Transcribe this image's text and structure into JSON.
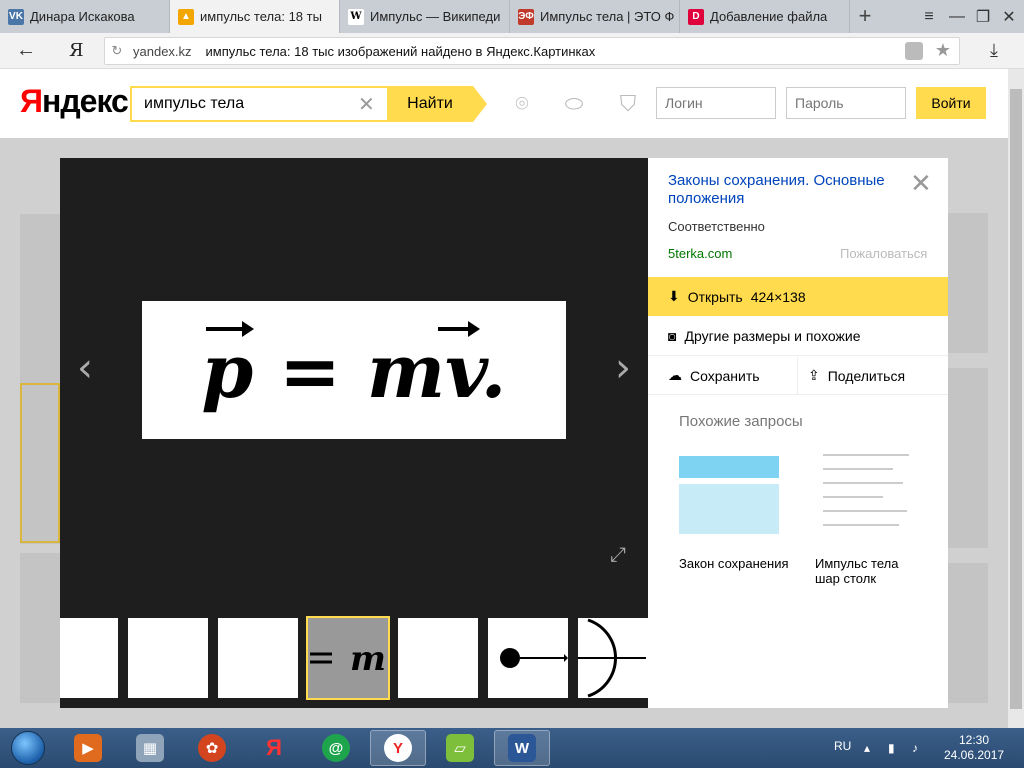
{
  "browser": {
    "tabs": [
      {
        "label": "Динара Искакова",
        "favicon": "vk-icon",
        "color": "#4a76a8",
        "active": false
      },
      {
        "label": "импульс тела: 18 ты",
        "favicon": "yandex-images-icon",
        "color": "#f3a600",
        "active": true
      },
      {
        "label": "Импульс — Википеди",
        "favicon": "wikipedia-icon",
        "color": "#ffffff",
        "active": false
      },
      {
        "label": "Импульс тела | ЭТО Ф",
        "favicon": "etof-icon",
        "color": "#c0392b",
        "active": false
      },
      {
        "label": "Добавление файла",
        "favicon": "d-icon",
        "color": "#e0003c",
        "active": false
      }
    ],
    "new_tab": "+",
    "address": {
      "domain": "yandex.kz",
      "title": "импульс тела: 18 тыс изображений найдено в Яндекс.Картинках"
    }
  },
  "header": {
    "logo_red": "Я",
    "logo_black": "ндекс",
    "search": {
      "value": "импульс тела",
      "button": "Найти"
    },
    "login_placeholder": "Логин",
    "password_placeholder": "Пароль",
    "login_button": "Войти"
  },
  "viewer": {
    "formula": "p = mv.",
    "selected_thumb": 3
  },
  "side_panel": {
    "title": "Законы сохранения. Основные положения",
    "description": "Соответственно",
    "source": "5terka.com",
    "report": "Пожаловаться",
    "open_label": "Открыть",
    "open_size": "424×138",
    "similar_sizes": "Другие размеры и похожие",
    "save": "Сохранить",
    "share": "Поделиться",
    "related_heading": "Похожие запросы",
    "related": [
      {
        "label": "Закон сохранения"
      },
      {
        "label": "Импульс тела шар столк"
      }
    ]
  },
  "taskbar": {
    "lang": "RU",
    "time": "12:30",
    "date": "24.06.2017"
  },
  "colors": {
    "accent": "#ffdb4d",
    "link": "#0044bb",
    "source": "#007700"
  }
}
